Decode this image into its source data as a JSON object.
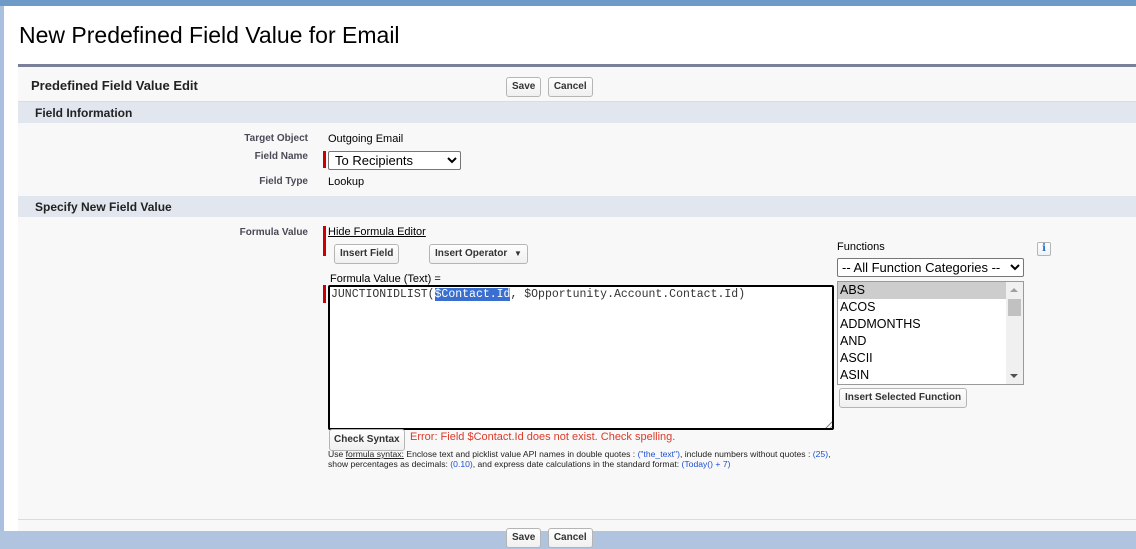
{
  "page": {
    "title": "New Predefined Field Value for Email"
  },
  "block": {
    "title": "Predefined Field Value Edit",
    "save_label": "Save",
    "cancel_label": "Cancel"
  },
  "field_information": {
    "heading": "Field Information",
    "target_object_label": "Target Object",
    "target_object_value": "Outgoing Email",
    "field_name_label": "Field Name",
    "field_name_selected": "To Recipients",
    "field_type_label": "Field Type",
    "field_type_value": "Lookup"
  },
  "specify_value": {
    "heading": "Specify New Field Value",
    "formula_value_label": "Formula Value",
    "hide_editor_link": "Hide Formula Editor",
    "insert_field_label": "Insert Field",
    "insert_operator_label": "Insert Operator",
    "formula_caption": "Formula Value (Text) =",
    "formula": {
      "prefix": "JUNCTIONIDLIST(",
      "selected": "$Contact.Id",
      "suffix": ", $Opportunity.Account.Contact.Id)"
    },
    "check_syntax_label": "Check Syntax",
    "error_message": "Error: Field $Contact.Id does not exist. Check spelling.",
    "hint": {
      "use": "Use ",
      "link": "formula syntax:",
      "part1": " Enclose text and picklist value API names in double quotes : ",
      "ex1": "(\"the_text\")",
      "part2": ", include numbers without quotes : ",
      "ex2": "(25)",
      "part3": ", show percentages as decimals: ",
      "ex3": "(0.10)",
      "part4": ", and express date calculations in the standard format: ",
      "ex4": "(Today() + 7)"
    },
    "functions": {
      "label": "Functions",
      "category_selected": "-- All Function Categories --",
      "items": [
        "ABS",
        "ACOS",
        "ADDMONTHS",
        "AND",
        "ASCII",
        "ASIN"
      ],
      "selected_item": "ABS",
      "insert_selected_label": "Insert Selected Function",
      "info_icon": "i"
    }
  },
  "footer": {
    "save_label": "Save",
    "cancel_label": "Cancel"
  },
  "colors": {
    "required": "#cc0000",
    "error": "#d93b2b",
    "hint_example": "#1a4fd6",
    "section_bar": "#e2e6ef",
    "block_border": "#7a8099"
  }
}
